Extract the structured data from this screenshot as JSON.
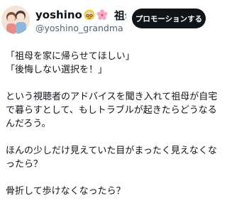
{
  "profile": {
    "display_name": "yoshino",
    "name_rest": "祖母...",
    "handle": "@yoshino_grandma",
    "emoji_icons": [
      "grandmother-emoji-icon",
      "cherry-blossom-icon"
    ]
  },
  "promotion_button": {
    "label": "プロモーションする"
  },
  "post": {
    "lines": [
      "「祖母を家に帰らせてほしい」",
      "「後悔しない選択を！」",
      "",
      "という視聴者のアドバイスを聞き入れて祖母が自宅",
      "で暮らすとして、もしトラブルが起きたらどうなる",
      "んだろう。",
      "",
      "ほんの少しだけ見えていた目がまったく見えなくな",
      "ったら？",
      "",
      "骨折して歩けなくなったら？"
    ]
  },
  "colors": {
    "text": "#0f1419",
    "muted": "#536471",
    "button_bg": "#0f1419",
    "button_text": "#ffffff"
  }
}
